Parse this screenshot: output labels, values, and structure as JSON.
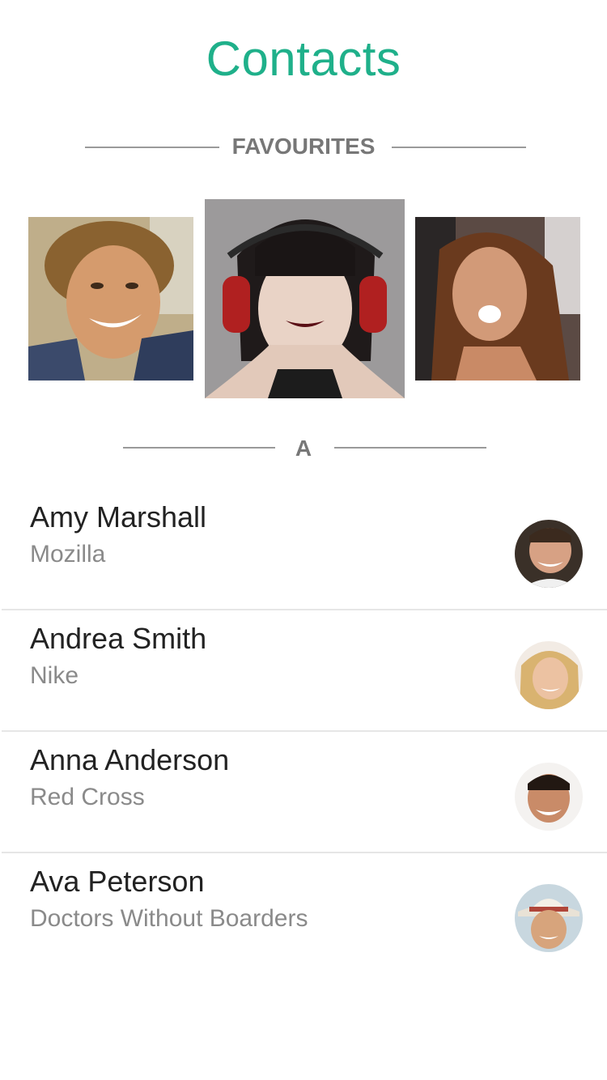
{
  "header": {
    "title": "Contacts"
  },
  "favourites": {
    "label": "FAVOURITES",
    "items": [
      {
        "photo": "man-smiling-photo"
      },
      {
        "photo": "woman-headphones-photo"
      },
      {
        "photo": "woman-laughing-photo"
      }
    ]
  },
  "section": {
    "letter": "A"
  },
  "contacts": [
    {
      "name": "Amy Marshall",
      "company": "Mozilla",
      "avatar": "avatar-man-smiling"
    },
    {
      "name": "Andrea Smith",
      "company": "Nike",
      "avatar": "avatar-blonde-woman"
    },
    {
      "name": "Anna Anderson",
      "company": "Red Cross",
      "avatar": "avatar-man-grinning"
    },
    {
      "name": "Ava Peterson",
      "company": "Doctors Without Boarders",
      "avatar": "avatar-woman-hat"
    }
  ],
  "colors": {
    "accent": "#1fb08a",
    "divider": "#9a9a9a",
    "label": "#777777"
  }
}
